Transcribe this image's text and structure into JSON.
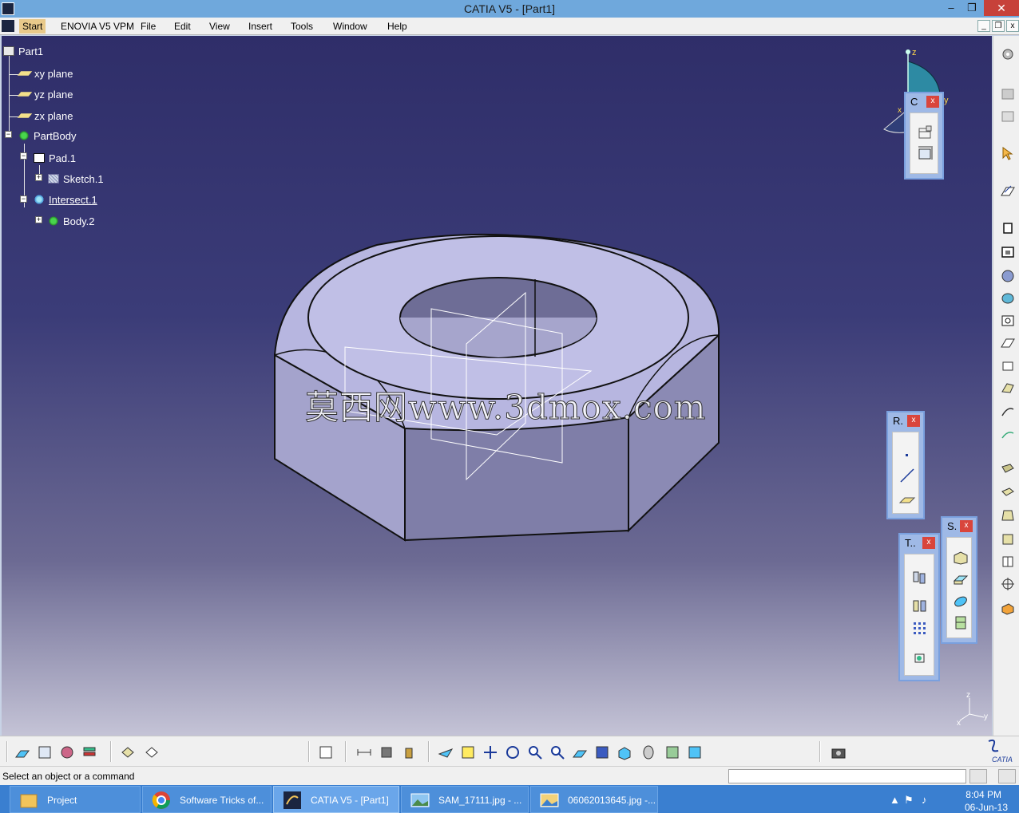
{
  "window": {
    "title": "CATIA V5 - [Part1]",
    "minimize_glyph": "–",
    "restore_glyph": "❐",
    "close_glyph": "✕"
  },
  "menu": {
    "items": [
      "Start",
      "ENOVIA V5 VPM",
      "File",
      "Edit",
      "View",
      "Insert",
      "Tools",
      "Window",
      "Help"
    ],
    "doc_minimize": "_",
    "doc_restore": "❐",
    "doc_close": "x"
  },
  "tree": {
    "root": "Part1",
    "planes": [
      "xy plane",
      "yz plane",
      "zx plane"
    ],
    "body": "PartBody",
    "pad": "Pad.1",
    "sketch": "Sketch.1",
    "intersect": "Intersect.1",
    "body2": "Body.2"
  },
  "watermark": "莫西网www.3dmox.com",
  "compass": {
    "z": "z",
    "y": "y",
    "x": "x"
  },
  "axis_triad": {
    "z": "z",
    "y": "y",
    "x": "x"
  },
  "floating_toolbars": {
    "constraints": {
      "title": "C",
      "close": "x"
    },
    "reference": {
      "title": "R.",
      "close": "x"
    },
    "transformation": {
      "title": "T..",
      "close": "x"
    },
    "surface": {
      "title": "S.",
      "close": "x"
    }
  },
  "status": {
    "message": "Select an object or a command",
    "command_value": ""
  },
  "brand": {
    "logo_text": "CATIA"
  },
  "taskbar": {
    "buttons": [
      {
        "label": "Project",
        "icon": "folder-icon"
      },
      {
        "label": "Software Tricks of...",
        "icon": "chrome-icon"
      },
      {
        "label": "CATIA V5 - [Part1]",
        "icon": "catia-icon"
      },
      {
        "label": "SAM_17111.jpg - ...",
        "icon": "image-viewer-icon"
      },
      {
        "label": "06062013645.jpg -...",
        "icon": "image-viewer-icon"
      }
    ],
    "time": "8:04 PM",
    "date": "06-Jun-13"
  },
  "colors": {
    "viewport_top": "#2f2e69",
    "part_face": "#a9a8d6",
    "taskbar": "#3a7fd0",
    "titlebar": "#6fa8dc"
  }
}
